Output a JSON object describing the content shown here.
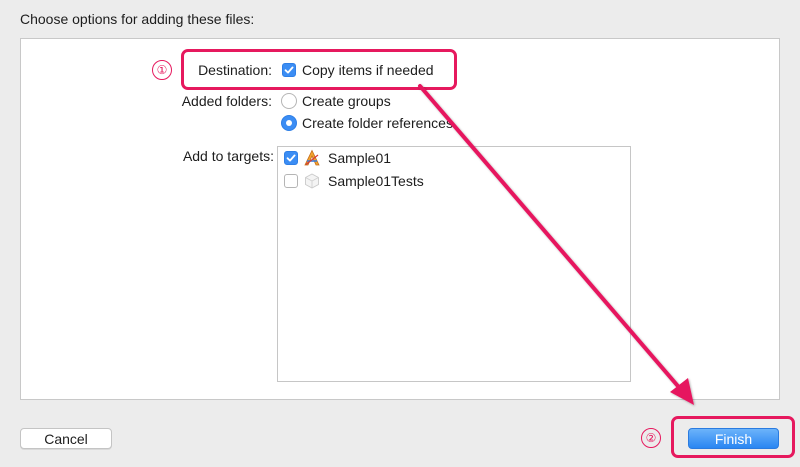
{
  "dialog": {
    "title": "Choose options for adding these files:"
  },
  "options": {
    "destination_label": "Destination:",
    "copy_items_label": "Copy items if needed",
    "copy_items_checked": true,
    "added_folders_label": "Added folders:",
    "folder_options": [
      {
        "label": "Create groups",
        "selected": false
      },
      {
        "label": "Create folder references",
        "selected": true
      }
    ],
    "add_to_targets_label": "Add to targets:",
    "targets": [
      {
        "label": "Sample01",
        "checked": true,
        "icon": "app-target-icon"
      },
      {
        "label": "Sample01Tests",
        "checked": false,
        "icon": "test-bundle-icon"
      }
    ]
  },
  "buttons": {
    "cancel": "Cancel",
    "finish": "Finish"
  },
  "annotations": {
    "step1": "①",
    "step2": "②",
    "highlight_color": "#e6195e"
  },
  "colors": {
    "accent": "#3b8df4",
    "background": "#ececec",
    "panel": "#ffffff"
  }
}
